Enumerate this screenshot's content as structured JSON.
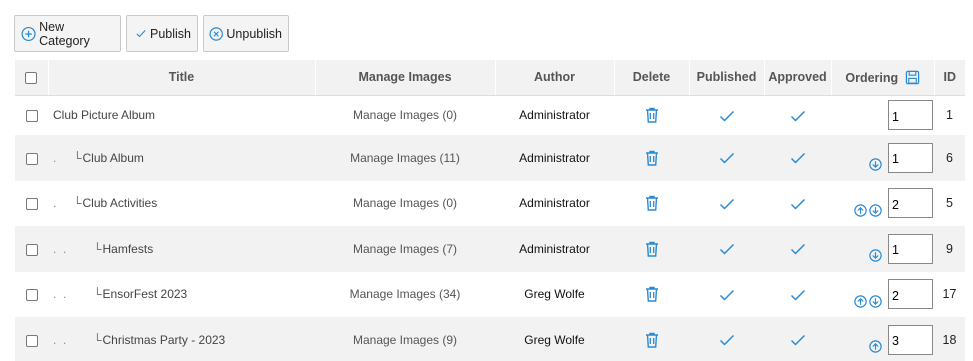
{
  "toolbar": {
    "new_category": "New Category",
    "publish": "Publish",
    "unpublish": "Unpublish"
  },
  "columns": {
    "title": "Title",
    "manage": "Manage Images",
    "author": "Author",
    "delete": "Delete",
    "published": "Published",
    "approved": "Approved",
    "ordering": "Ordering",
    "id": "ID"
  },
  "rows": [
    {
      "dots": "",
      "title": "Club Picture Album",
      "manage": "Manage Images (0)",
      "author": "Administrator",
      "order": "1",
      "id": "1"
    },
    {
      "dots": ".",
      "title": "Club Album",
      "manage": "Manage Images (11)",
      "author": "Administrator",
      "order": "1",
      "id": "6"
    },
    {
      "dots": ".",
      "title": "Club Activities",
      "manage": "Manage Images (0)",
      "author": "Administrator",
      "order": "2",
      "id": "5"
    },
    {
      "dots": ".  .",
      "title": "Hamfests",
      "manage": "Manage Images (7)",
      "author": "Administrator",
      "order": "1",
      "id": "9"
    },
    {
      "dots": ".  .",
      "title": "EnsorFest 2023",
      "manage": "Manage Images (34)",
      "author": "Greg Wolfe",
      "order": "2",
      "id": "17"
    },
    {
      "dots": ".  .",
      "title": "Christmas Party - 2023",
      "manage": "Manage Images (9)",
      "author": "Greg Wolfe",
      "order": "3",
      "id": "18"
    }
  ],
  "colors": {
    "accent": "#2a8ad4",
    "header_bg": "#f2f2f2",
    "stripe_bg": "#f2f2f2"
  },
  "icons": {
    "new": "plus-circle-icon",
    "publish": "check-icon",
    "unpublish": "x-circle-icon",
    "save_order": "floppy-disk-icon",
    "delete": "trash-icon",
    "published": "check-icon",
    "approved": "check-icon",
    "move_up": "arrow-up-circle-icon",
    "move_down": "arrow-down-circle-icon"
  }
}
